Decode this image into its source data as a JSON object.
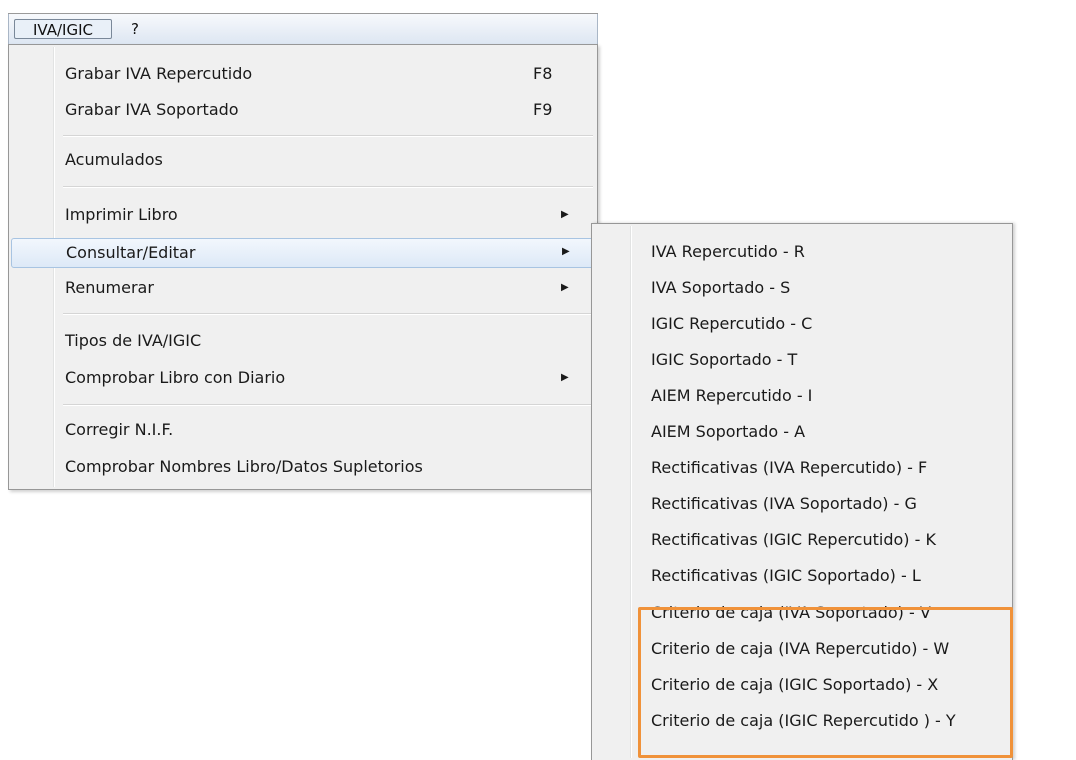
{
  "menubar": {
    "items": [
      {
        "label": "IVA/IGIC"
      },
      {
        "label": "?"
      }
    ]
  },
  "main_menu": {
    "items": [
      {
        "label": "Grabar IVA Repercutido",
        "shortcut": "F8"
      },
      {
        "label": "Grabar IVA Soportado",
        "shortcut": "F9"
      },
      {
        "label": "Acumulados"
      },
      {
        "label": "Imprimir Libro",
        "submenu": true
      },
      {
        "label": "Consultar/Editar",
        "submenu": true,
        "highlighted": true
      },
      {
        "label": "Renumerar",
        "submenu": true
      },
      {
        "label": "Tipos de IVA/IGIC"
      },
      {
        "label": "Comprobar Libro con Diario",
        "submenu": true
      },
      {
        "label": "Corregir N.I.F."
      },
      {
        "label": "Comprobar Nombres Libro/Datos Supletorios"
      }
    ],
    "arrow_glyph": "▶"
  },
  "submenu": {
    "items": [
      {
        "label": "IVA Repercutido - R"
      },
      {
        "label": "IVA Soportado - S"
      },
      {
        "label": "IGIC Repercutido - C"
      },
      {
        "label": "IGIC Soportado - T"
      },
      {
        "label": "AIEM Repercutido - I"
      },
      {
        "label": "AIEM Soportado - A"
      },
      {
        "label": "Rectificativas (IVA Repercutido) - F"
      },
      {
        "label": "Rectificativas (IVA Soportado) - G"
      },
      {
        "label": "Rectificativas (IGIC Repercutido) - K"
      },
      {
        "label": "Rectificativas (IGIC Soportado) - L"
      },
      {
        "label": "Criterio de caja (IVA Soportado) - V"
      },
      {
        "label": "Criterio de caja (IVA Repercutido) - W"
      },
      {
        "label": "Criterio de caja (IGIC Soportado) - X"
      },
      {
        "label": "Criterio de caja (IGIC Repercutido ) - Y"
      }
    ]
  },
  "colors": {
    "highlight_box": "#f0923a",
    "menu_background": "#f0f0f0",
    "hover_border": "#a8c4e2"
  }
}
